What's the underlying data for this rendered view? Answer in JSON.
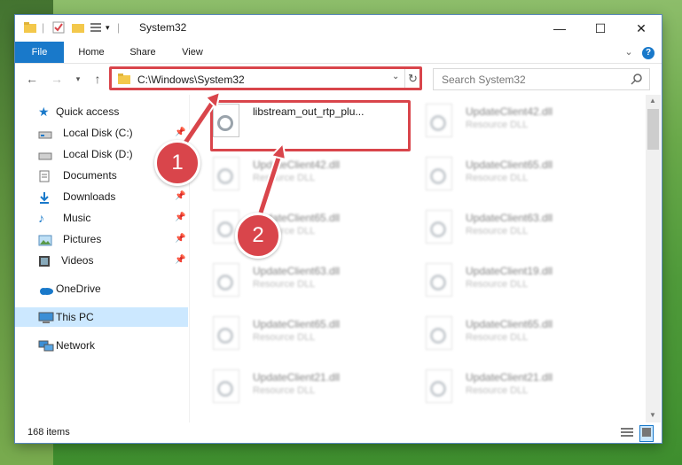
{
  "window": {
    "title": "System32"
  },
  "colors": {
    "accent": "#1979ca",
    "highlight": "#d9454b",
    "selected": "#cce8ff"
  },
  "ribbon": {
    "tabs": [
      "File",
      "Home",
      "Share",
      "View"
    ]
  },
  "address": {
    "path": "C:\\Windows\\System32",
    "search_placeholder": "Search System32"
  },
  "nav": {
    "items": [
      {
        "label": "Quick access",
        "icon": "star-icon"
      },
      {
        "label": "Local Disk (C:)",
        "icon": "drive-icon",
        "pinned": true
      },
      {
        "label": "Local Disk (D:)",
        "icon": "drive-icon",
        "pinned": true
      },
      {
        "label": "Documents",
        "icon": "documents-icon",
        "pinned": true
      },
      {
        "label": "Downloads",
        "icon": "download-icon",
        "pinned": true
      },
      {
        "label": "Music",
        "icon": "music-icon",
        "pinned": true
      },
      {
        "label": "Pictures",
        "icon": "pictures-icon",
        "pinned": true
      },
      {
        "label": "Videos",
        "icon": "videos-icon",
        "pinned": true
      },
      {
        "label": "OneDrive",
        "icon": "cloud-icon"
      },
      {
        "label": "This PC",
        "icon": "computer-icon",
        "selected": true
      },
      {
        "label": "Network",
        "icon": "network-icon"
      }
    ]
  },
  "files": {
    "highlighted": {
      "name": "libstream_out_rtp_plu..."
    },
    "items": [
      {
        "name": "UpdateClient42.dll",
        "type": "Resource DLL"
      },
      {
        "name": "UpdateClient42.dll",
        "type": "Resource DLL"
      },
      {
        "name": "UpdateClient65.dll",
        "type": "Resource DLL"
      },
      {
        "name": "UpdateClient65.dll",
        "type": "Resource DLL"
      },
      {
        "name": "UpdateClient63.dll",
        "type": "Resource DLL"
      },
      {
        "name": "UpdateClient63.dll",
        "type": "Resource DLL"
      },
      {
        "name": "UpdateClient19.dll",
        "type": "Resource DLL"
      },
      {
        "name": "UpdateClient65.dll",
        "type": "Resource DLL"
      },
      {
        "name": "UpdateClient65.dll",
        "type": "Resource DLL"
      },
      {
        "name": "UpdateClient21.dll",
        "type": "Resource DLL"
      },
      {
        "name": "UpdateClient21.dll",
        "type": "Resource DLL"
      }
    ]
  },
  "status": {
    "count": "168 items"
  },
  "callouts": [
    "1",
    "2"
  ]
}
